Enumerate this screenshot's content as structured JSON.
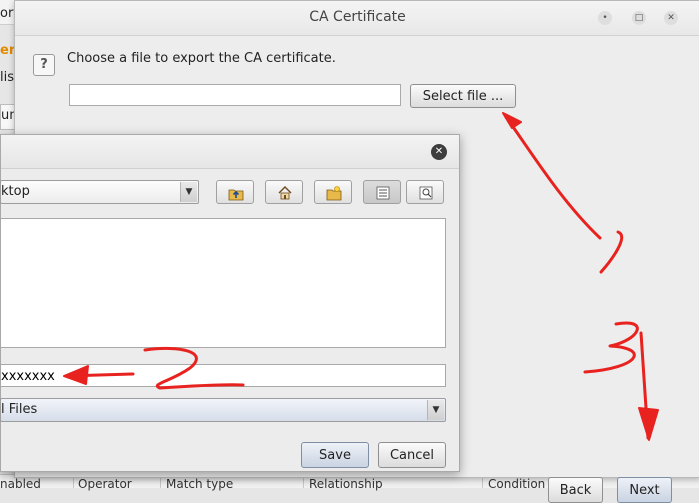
{
  "background_app": {
    "top_fragment": "ory",
    "orange_fragment": "er",
    "left_fragment": "lis",
    "tab_fragment": "un",
    "right_fragment_1": "o",
    "right_fragment_2": "'o",
    "table_columns": [
      "nabled",
      "Operator",
      "Match type",
      "Relationship",
      "Condition"
    ]
  },
  "ca_dialog": {
    "title": "CA Certificate",
    "prompt": "Choose a file to export the CA certificate.",
    "path_value": "",
    "select_file_label": "Select file ...",
    "back_label": "Back",
    "next_label": "Next"
  },
  "file_chooser": {
    "look_in_value": "ktop",
    "file_name_value": "xxxxxxx",
    "file_type_value": "l Files",
    "save_label": "Save",
    "cancel_label": "Cancel"
  },
  "annotations": {
    "color": "#e8231f",
    "marks": [
      "1",
      "2",
      "3"
    ]
  }
}
